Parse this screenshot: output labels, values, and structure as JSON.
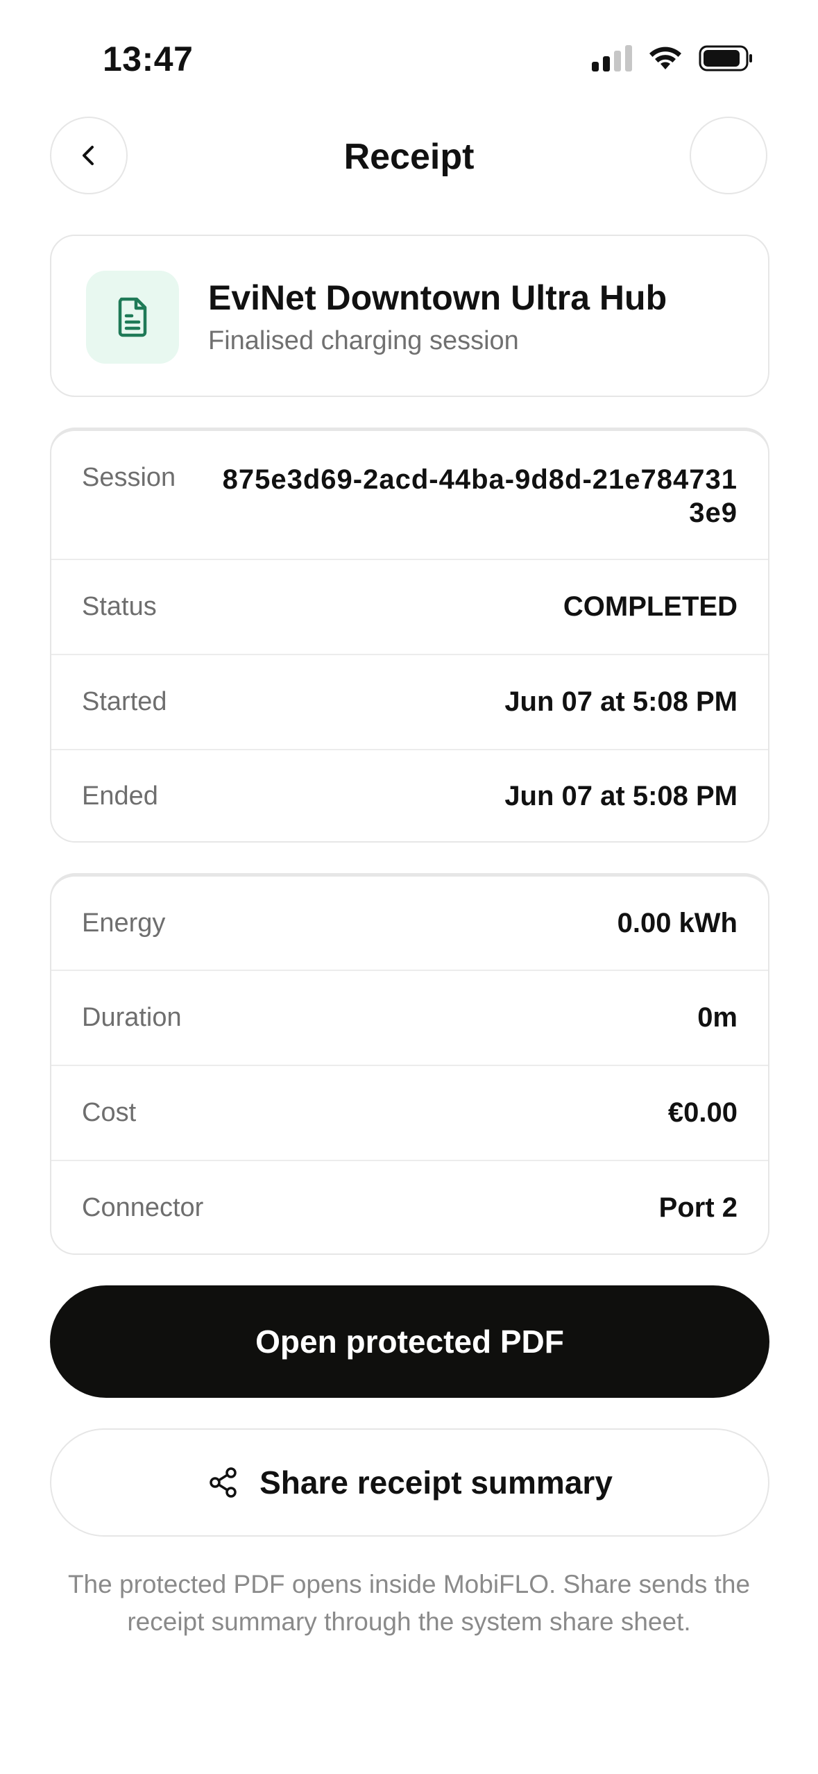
{
  "status_bar": {
    "time": "13:47"
  },
  "header": {
    "title": "Receipt"
  },
  "station": {
    "name": "EviNet Downtown Ultra Hub",
    "subtitle": "Finalised charging session",
    "icon": "document-icon",
    "icon_color": "#1f7a57",
    "icon_bg": "#e8f8f0"
  },
  "session_details": [
    {
      "label": "Session",
      "value": "875e3d69-2acd-44ba-9d8d-21e7847313e9"
    },
    {
      "label": "Status",
      "value": "COMPLETED"
    },
    {
      "label": "Started",
      "value": "Jun 07 at 5:08 PM"
    },
    {
      "label": "Ended",
      "value": "Jun 07 at 5:08 PM"
    }
  ],
  "charge_details": [
    {
      "label": "Energy",
      "value": "0.00 kWh"
    },
    {
      "label": "Duration",
      "value": "0m"
    },
    {
      "label": "Cost",
      "value": "€0.00"
    },
    {
      "label": "Connector",
      "value": "Port 2"
    }
  ],
  "actions": {
    "open_pdf_label": "Open protected PDF",
    "share_label": "Share receipt summary",
    "share_icon": "share-icon"
  },
  "footnote": "The protected PDF opens inside MobiFLO. Share sends the receipt summary through the system share sheet.",
  "colors": {
    "primary_button": "#0f0f0d",
    "muted_text": "#6e6e6e"
  }
}
